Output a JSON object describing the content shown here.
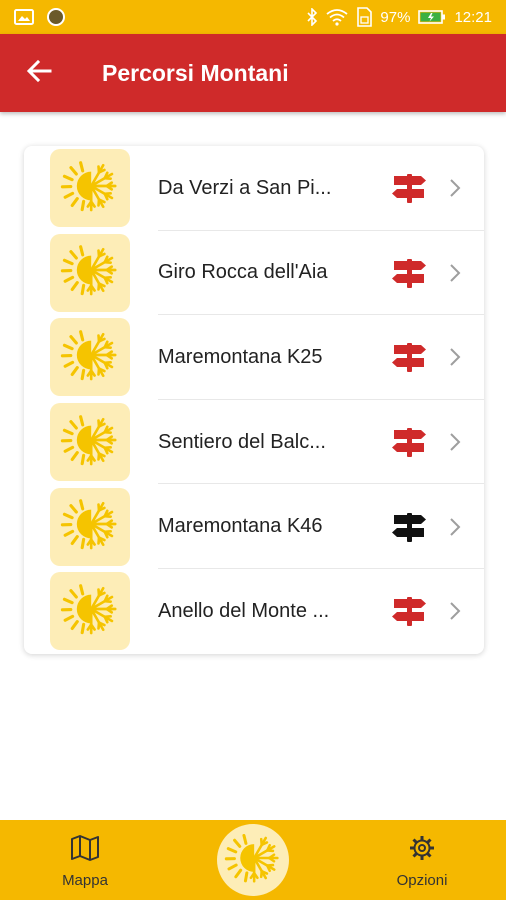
{
  "status_bar": {
    "battery_percent": "97%",
    "time": "12:21",
    "icons": [
      "gallery-icon",
      "circle-icon",
      "bluetooth-icon",
      "wifi-icon",
      "sim-icon",
      "battery-icon"
    ]
  },
  "app_bar": {
    "title": "Percorsi Montani",
    "back_icon": "arrow-left-icon"
  },
  "routes": [
    {
      "label": "Da Verzi a San Pi...",
      "sign_color": "#cf2a2a"
    },
    {
      "label": "Giro Rocca dell'Aia",
      "sign_color": "#cf2a2a"
    },
    {
      "label": "Maremontana K25",
      "sign_color": "#cf2a2a"
    },
    {
      "label": "Sentiero del Balc...",
      "sign_color": "#cf2a2a"
    },
    {
      "label": "Maremontana K46",
      "sign_color": "#111111"
    },
    {
      "label": "Anello del Monte ...",
      "sign_color": "#cf2a2a"
    }
  ],
  "bottom_nav": {
    "mappa_label": "Mappa",
    "opzioni_label": "Opzioni",
    "center_icon": "sun-snowflake-icon"
  },
  "colors": {
    "accent_yellow": "#f5b800",
    "app_bar_red": "#cf2a2a",
    "thumb_bg": "#fdedb7",
    "logo_yellow": "#f5c400"
  }
}
